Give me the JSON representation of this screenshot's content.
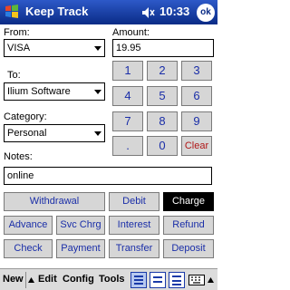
{
  "titlebar": {
    "title": "Keep Track",
    "time": "10:33",
    "ok_label": "ok",
    "start_icon": "windows-flag-icon",
    "volume_icon": "speaker-icon"
  },
  "form": {
    "from_label": "From:",
    "from_value": "VISA",
    "to_label": "To:",
    "to_value": "Ilium Software",
    "category_label": "Category:",
    "category_value": "Personal",
    "notes_label": "Notes:",
    "notes_value": "online",
    "amount_label": "Amount:",
    "amount_value": "19.95"
  },
  "keypad": {
    "k1": "1",
    "k2": "2",
    "k3": "3",
    "k4": "4",
    "k5": "5",
    "k6": "6",
    "k7": "7",
    "k8": "8",
    "k9": "9",
    "kdot": ".",
    "k0": "0",
    "kclear": "Clear"
  },
  "types": {
    "withdrawal": "Withdrawal",
    "debit": "Debit",
    "charge": "Charge",
    "advance": "Advance",
    "svc_chrg": "Svc Chrg",
    "interest": "Interest",
    "refund": "Refund",
    "check": "Check",
    "payment": "Payment",
    "transfer": "Transfer",
    "deposit": "Deposit",
    "selected": "Charge"
  },
  "menubar": {
    "new": "New",
    "edit": "Edit",
    "config": "Config",
    "tools": "Tools"
  },
  "colors": {
    "titlebar": "#0a2b86",
    "button_text": "#1a2ea8",
    "clear_text": "#b01818",
    "selected_bg": "#000000"
  }
}
